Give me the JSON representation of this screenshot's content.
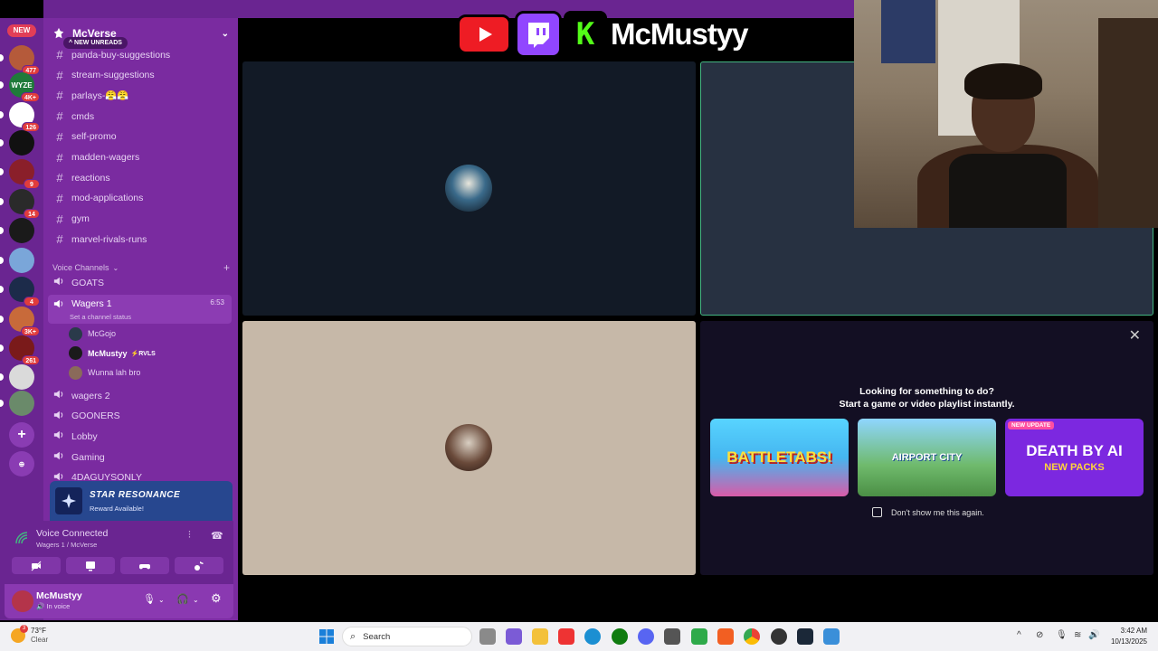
{
  "server": {
    "name": "McVerse",
    "new_label": "NEW",
    "new_unreads": "NEW UNREADS",
    "servers": [
      {
        "badge": "477",
        "color": "#b55a3a"
      },
      {
        "badge": "4K+",
        "color": "#1f7a3a",
        "text": "WYZE"
      },
      {
        "badge": "126",
        "color": "#ffffff"
      },
      {
        "badge": "",
        "color": "#111111"
      },
      {
        "badge": "9",
        "color": "#8a1f2a"
      },
      {
        "badge": "14",
        "color": "#2a2a2a"
      },
      {
        "badge": "",
        "color": "#1a1a1a"
      },
      {
        "badge": "",
        "color": "#7aa6d9"
      },
      {
        "badge": "4",
        "color": "#1c2b4a"
      },
      {
        "badge": "3K+",
        "color": "#c86a3a"
      },
      {
        "badge": "261",
        "color": "#7a1a1a"
      },
      {
        "badge": "",
        "color": "#dadada"
      },
      {
        "badge": "",
        "color": "#6a8a6a"
      }
    ]
  },
  "channels": [
    "panda-buy-suggestions",
    "stream-suggestions",
    "parlays-😤😤",
    "cmds",
    "self-promo",
    "madden-wagers",
    "reactions",
    "mod-applications",
    "gym",
    "marvel-rivals-runs"
  ],
  "voice": {
    "header": "Voice Channels",
    "channels_before": [
      "GOATS"
    ],
    "active": {
      "name": "Wagers 1",
      "time": "6:53",
      "status": "Set a channel status"
    },
    "users": [
      {
        "name": "McGojo",
        "tag": ""
      },
      {
        "name": "McMustyy",
        "tag": "⚡RVLS"
      },
      {
        "name": "Wunna lah bro",
        "tag": ""
      }
    ],
    "channels_after": [
      "wagers 2",
      "GOONERS",
      "Lobby",
      "Gaming",
      "4DAGUYSONLY"
    ]
  },
  "promo": {
    "title": "STAR RESONANCE",
    "subtitle": "Reward Available!"
  },
  "voice_panel": {
    "status": "Voice Connected",
    "location": "Wagers 1 / McVerse"
  },
  "user": {
    "name": "McMustyy",
    "status": "In voice"
  },
  "stream_overlay": {
    "name": "McMustyy",
    "kick_letter": "K"
  },
  "activity": {
    "heading1": "Looking for something to do?",
    "heading2": "Start a game or video playlist instantly.",
    "games": [
      {
        "title": "BATTLETABS!"
      },
      {
        "title": "AIRPORT CITY"
      },
      {
        "title": "DEATH BY AI",
        "sub": "NEW PACKS",
        "badge": "NEW UPDATE"
      }
    ],
    "dont_show": "Don't show me this again."
  },
  "taskbar": {
    "temp": "73°F",
    "condition": "Clear",
    "weather_badge": "3",
    "search": "Search",
    "time": "3:42 AM",
    "date": "10/13/2025"
  }
}
